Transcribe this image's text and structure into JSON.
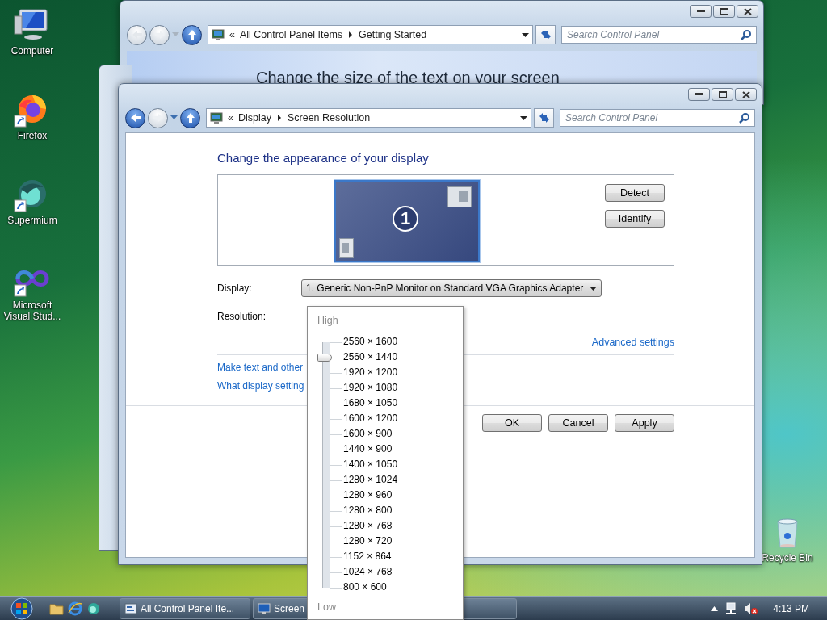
{
  "desktop_icons": [
    {
      "label": "Computer",
      "kind": "computer",
      "shortcut": false
    },
    {
      "label": "Firefox",
      "kind": "firefox",
      "shortcut": true
    },
    {
      "label": "Supermium",
      "kind": "supermium",
      "shortcut": true
    },
    {
      "label": "Microsoft Visual Stud...",
      "kind": "infinity",
      "shortcut": true
    }
  ],
  "recycle_bin": {
    "label": "Recycle Bin"
  },
  "back_window": {
    "back_enabled": false,
    "breadcrumb_prefix": "«",
    "breadcrumb": [
      "All Control Panel Items",
      "Getting Started"
    ],
    "search": {
      "placeholder": "Search Control Panel"
    },
    "banner_title": "Change the size of the text on your screen"
  },
  "window": {
    "back_enabled": true,
    "breadcrumb_prefix": "«",
    "breadcrumb": [
      "Display",
      "Screen Resolution"
    ],
    "search": {
      "placeholder": "Search Control Panel"
    },
    "heading": "Change the appearance of your display",
    "monitor_number": "1",
    "side_buttons": [
      "Detect",
      "Identify"
    ],
    "display": {
      "label": "Display:",
      "value": "1. Generic Non-PnP Monitor on Standard VGA Graphics Adapter"
    },
    "resolution": {
      "label": "Resolution:"
    },
    "advanced_link": "Advanced settings",
    "links": [
      "Make text and other",
      "What display setting"
    ],
    "dialog_buttons": [
      "OK",
      "Cancel",
      "Apply"
    ]
  },
  "resolution_popup": {
    "high_label": "High",
    "low_label": "Low",
    "level": 0.9375,
    "options": [
      "2560 × 1600",
      "2560 × 1440",
      "1920 × 1200",
      "1920 × 1080",
      "1680 × 1050",
      "1600 × 1200",
      "1600 × 900",
      "1440 × 900",
      "1400 × 1050",
      "1280 × 1024",
      "1280 × 960",
      "1280 × 800",
      "1280 × 768",
      "1280 × 720",
      "1152 × 864",
      "1024 × 768",
      "800 × 600"
    ]
  },
  "taskbar": {
    "tasks": [
      "All Control Panel Ite...",
      "Screen"
    ],
    "clock": "4:13 PM"
  }
}
